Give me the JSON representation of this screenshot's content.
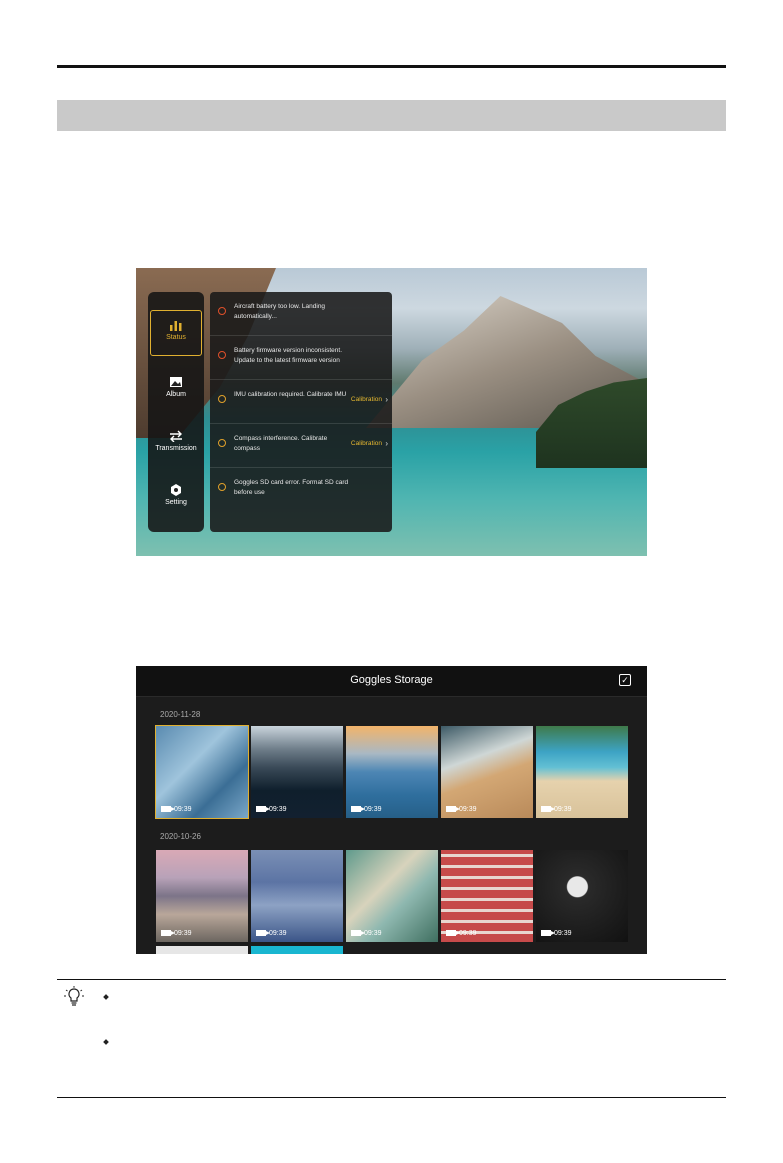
{
  "status_screen": {
    "tabs": [
      {
        "label": "Status",
        "icon": "status-bars-icon",
        "active": true
      },
      {
        "label": "Album",
        "icon": "album-icon",
        "active": false
      },
      {
        "label": "Transmission",
        "icon": "transmission-icon",
        "active": false
      },
      {
        "label": "Setting",
        "icon": "setting-icon",
        "active": false
      }
    ],
    "alerts": [
      {
        "text": "Aircraft battery too low. Landing automatically...",
        "severity": "red",
        "action": ""
      },
      {
        "text": "Battery firmware version inconsistent. Update to the latest firmware version",
        "severity": "red",
        "action": ""
      },
      {
        "text": "IMU calibration required. Calibrate IMU",
        "severity": "yellow",
        "action": "Calibration"
      },
      {
        "text": "Compass interference. Calibrate compass",
        "severity": "yellow",
        "action": "Calibration"
      },
      {
        "text": "Goggles SD card error. Format SD card before use",
        "severity": "yellow",
        "action": ""
      }
    ],
    "accent_color": "#e0b030"
  },
  "storage_screen": {
    "title": "Goggles Storage",
    "groups": [
      {
        "date": "2020-11-28",
        "items": [
          {
            "duration": "09:39",
            "selected": true
          },
          {
            "duration": "09:39",
            "selected": false
          },
          {
            "duration": "09:39",
            "selected": false
          },
          {
            "duration": "09:39",
            "selected": false
          },
          {
            "duration": "09:39",
            "selected": false
          }
        ]
      },
      {
        "date": "2020-10-26",
        "items": [
          {
            "duration": "09:39",
            "selected": false
          },
          {
            "duration": "09:39",
            "selected": false
          },
          {
            "duration": "09:39",
            "selected": false
          },
          {
            "duration": "09:39",
            "selected": false
          },
          {
            "duration": "09:39",
            "selected": false
          }
        ]
      }
    ]
  }
}
